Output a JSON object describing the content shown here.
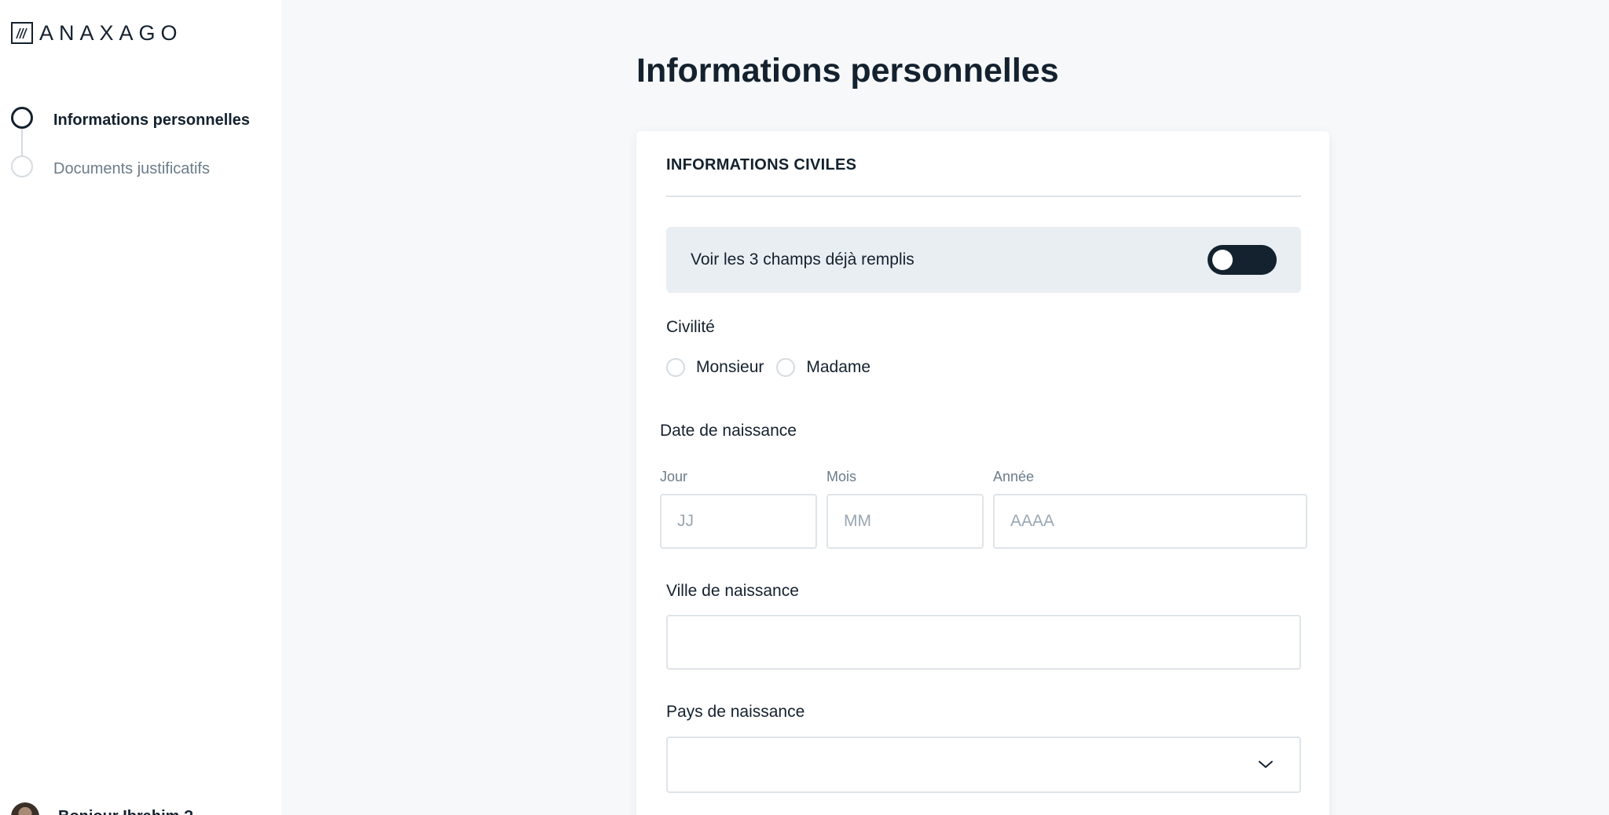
{
  "logo": {
    "text": "ANAXAGO"
  },
  "steps": [
    {
      "label": "Informations personnelles",
      "state": "active"
    },
    {
      "label": "Documents justificatifs",
      "state": "inactive"
    }
  ],
  "user": {
    "name": "Bonjour Ibrahim ?"
  },
  "page": {
    "title": "Informations personnelles"
  },
  "section": {
    "title": "INFORMATIONS CIVILES",
    "toggle_label": "Voir les 3 champs déjà remplis",
    "toggle_on": false
  },
  "civilite": {
    "label": "Civilité",
    "options": [
      "Monsieur",
      "Madame"
    ]
  },
  "birth_date": {
    "label": "Date de naissance",
    "day_label": "Jour",
    "day_placeholder": "JJ",
    "month_label": "Mois",
    "month_placeholder": "MM",
    "year_label": "Année",
    "year_placeholder": "AAAA"
  },
  "birth_city": {
    "label": "Ville de naissance",
    "value": ""
  },
  "birth_country": {
    "label": "Pays de naissance",
    "value": ""
  },
  "colors": {
    "primary": "#14212e",
    "muted": "#6b7c8a",
    "border": "#dfe4e8",
    "panel": "#e9eef2"
  }
}
